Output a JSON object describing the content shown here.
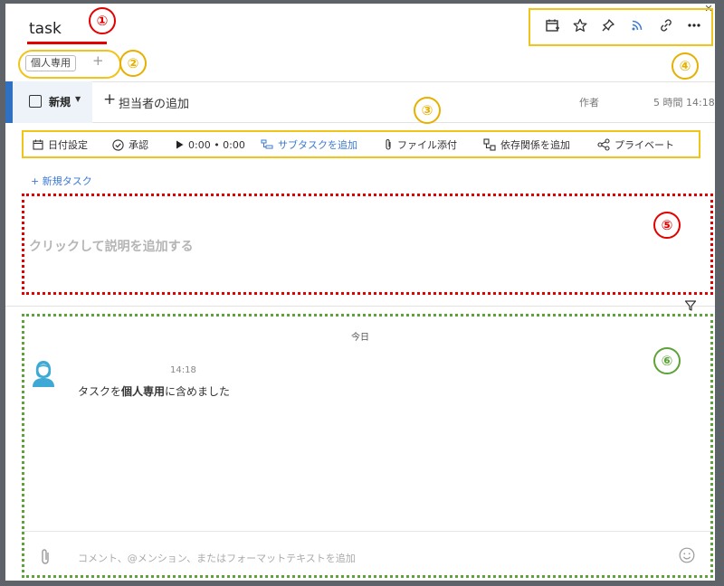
{
  "title": "task",
  "markers": [
    "①",
    "②",
    "③",
    "④",
    "⑤",
    "⑥"
  ],
  "tags": {
    "label": "個人専用",
    "add_symbol": "+"
  },
  "top_icons": [
    "calendar-plus-icon",
    "star-icon",
    "pin-icon",
    "rss-icon",
    "link-icon",
    "more-icon"
  ],
  "task_row": {
    "status_label": "新規",
    "assignee_plus": "+",
    "assignee_label": "担当者の追加",
    "author_label": "作者",
    "time_info": "5 時間 14:18"
  },
  "actions": {
    "date": "日付設定",
    "approve": "承認",
    "timer": "0:00 • 0:00",
    "subtask": "サブタスクを追加",
    "attach": "ファイル添付",
    "dependency": "依存関係を追加",
    "private": "プライベート"
  },
  "new_task": "+ 新規タスク",
  "description_placeholder": "クリックして説明を追加する",
  "activity": {
    "date_header": "今日",
    "message": {
      "time": "14:18",
      "text_before": "タスクを",
      "text_bold": "個人専用",
      "text_after": "に含めました"
    }
  },
  "comment_placeholder": "コメント、@メンション、またはフォーマットテキストを追加",
  "colors": {
    "accent_blue": "#3b7ad4",
    "marker_red": "#e40000",
    "marker_yellow": "#f0c419",
    "marker_green": "#5ea33a"
  }
}
